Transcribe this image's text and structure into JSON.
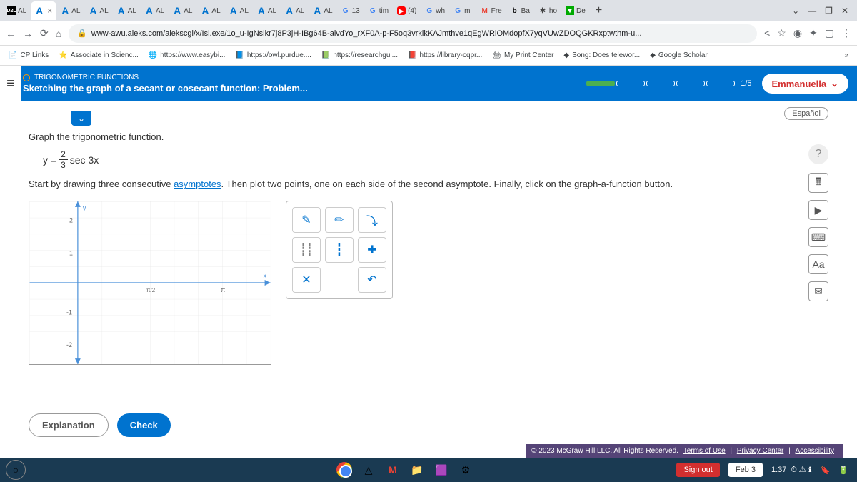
{
  "tabs": {
    "items": [
      "AL",
      "A",
      "AL",
      "AL",
      "AL",
      "AL",
      "AL",
      "AL",
      "AL",
      "AL",
      "AL",
      "AL",
      "13",
      "tim",
      "(4)",
      "wh",
      "mi",
      "Fre",
      "Ba",
      "ho",
      "De"
    ],
    "active_index": 1
  },
  "url": "www-awu.aleks.com/alekscgi/x/Isl.exe/1o_u-IgNslkr7j8P3jH-IBg64B-alvdYo_rXF0A-p-F5oq3vrklkKAJmthve1qEgWRiOMdopfX7yqVUwZDOQGKRxptwthm-u...",
  "bookmarks": [
    "CP Links",
    "Associate in Scienc...",
    "https://www.easybi...",
    "https://owl.purdue....",
    "https://researchgui...",
    "https://library-cqpr...",
    "My Print Center",
    "Song: Does telewor...",
    "Google Scholar"
  ],
  "header": {
    "category": "TRIGONOMETRIC FUNCTIONS",
    "title": "Sketching the graph of a secant or cosecant function: Problem...",
    "progress": "1/5",
    "user": "Emmanuella"
  },
  "lang_btn": "Español",
  "content": {
    "line1": "Graph the trigonometric function.",
    "eq_lhs": "y =",
    "eq_num": "2",
    "eq_den": "3",
    "eq_fn": "sec 3x",
    "line2_a": "Start by drawing three consecutive ",
    "line2_link": "asymptotes",
    "line2_b": ". Then plot two points, one on each side of the second asymptote. Finally, click on the graph-a-function button."
  },
  "chart_data": {
    "type": "line",
    "title": "",
    "xlabel": "x",
    "ylabel": "y",
    "xlim": [
      -1,
      3.5
    ],
    "ylim": [
      -2.5,
      2.5
    ],
    "xticks": [
      "π/2",
      "π"
    ],
    "yticks": [
      -2,
      -1,
      1,
      2
    ],
    "series": []
  },
  "actions": {
    "explain": "Explanation",
    "check": "Check"
  },
  "footer": {
    "copyright": "© 2023 McGraw Hill LLC. All Rights Reserved.",
    "links": [
      "Terms of Use",
      "Privacy Center",
      "Accessibility"
    ]
  },
  "status": {
    "signout": "Sign out",
    "date": "Feb 3",
    "time": "1:37"
  }
}
